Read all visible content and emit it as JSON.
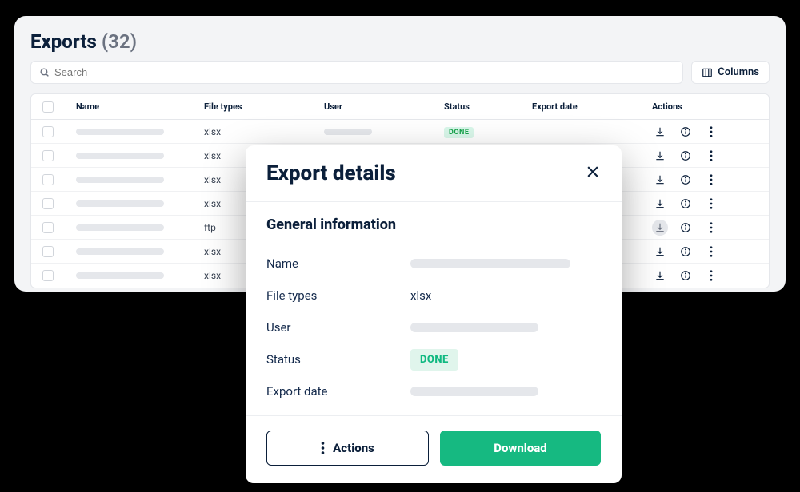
{
  "header": {
    "title": "Exports",
    "count": "(32)"
  },
  "search": {
    "placeholder": "Search"
  },
  "columns_button": {
    "label": "Columns"
  },
  "table": {
    "columns": [
      "Name",
      "File types",
      "User",
      "Status",
      "Export date",
      "Actions"
    ],
    "rows": [
      {
        "file_types": "xlsx",
        "status": "DONE"
      },
      {
        "file_types": "xlsx"
      },
      {
        "file_types": "xlsx"
      },
      {
        "file_types": "xlsx"
      },
      {
        "file_types": "ftp"
      },
      {
        "file_types": "xlsx"
      },
      {
        "file_types": "xlsx"
      }
    ]
  },
  "modal": {
    "title": "Export details",
    "section": "General information",
    "fields": {
      "name_label": "Name",
      "file_types_label": "File types",
      "file_types_value": "xlsx",
      "user_label": "User",
      "status_label": "Status",
      "status_value": "DONE",
      "export_date_label": "Export date"
    },
    "actions_label": "Actions",
    "download_label": "Download"
  }
}
